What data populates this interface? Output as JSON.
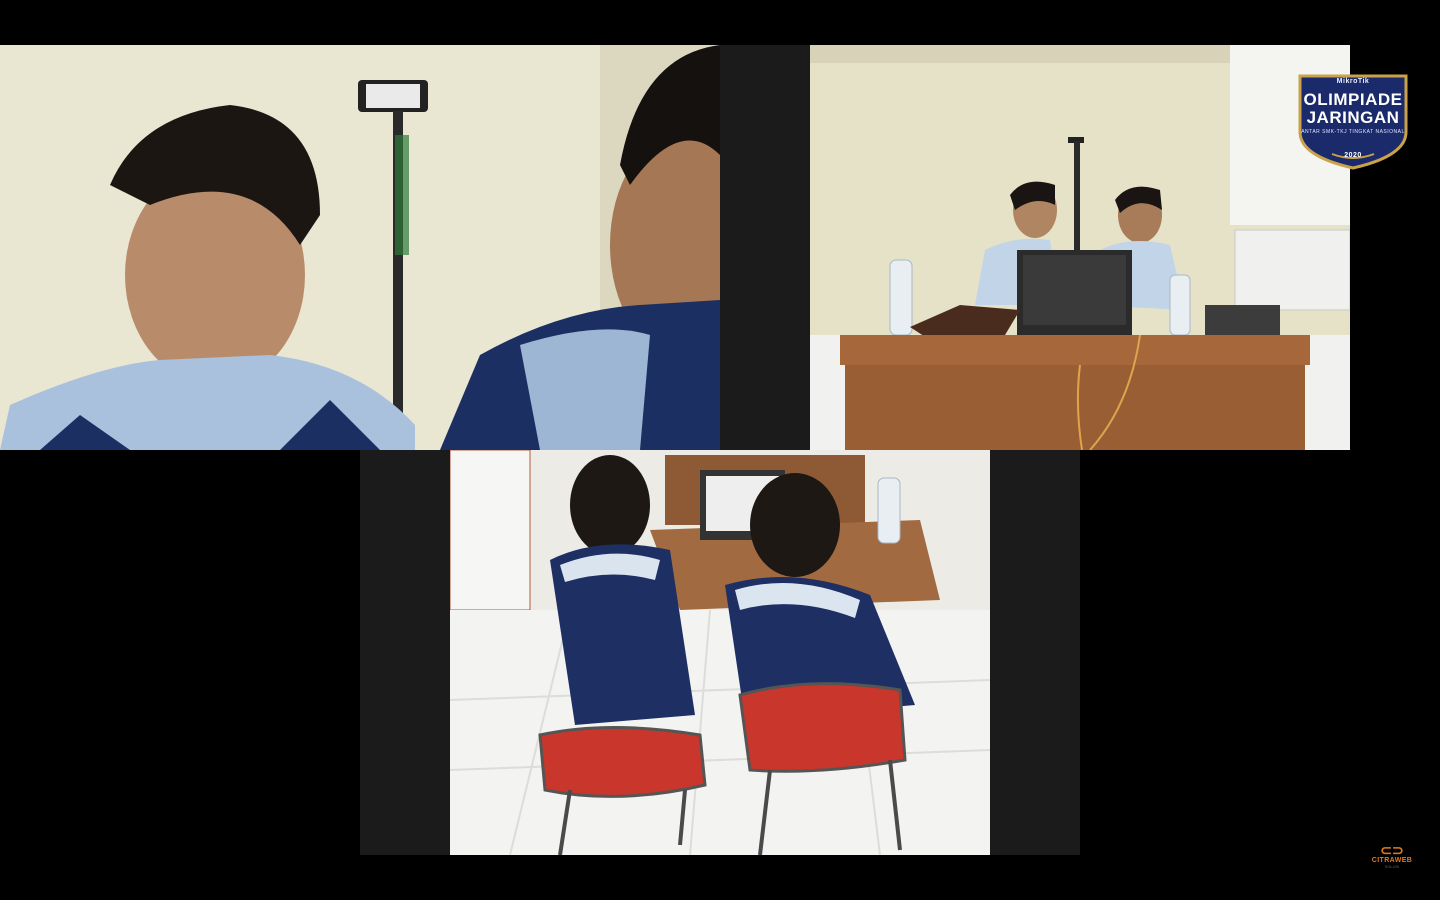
{
  "event_logo": {
    "brand": "MikroTik",
    "title_line1": "OLIMPIADE",
    "title_line2": "JARINGAN",
    "subtitle": "ANTAR SMK-TKJ TINGKAT NASIONAL",
    "year": "2020"
  },
  "sponsor_logo": {
    "mark": "⊂⊃",
    "name": "CITRAWEB",
    "tagline": "SOLUSI"
  },
  "colors": {
    "background": "#000000",
    "logo_navy": "#1b2a6b",
    "logo_gold": "#c9a24a",
    "sponsor_orange": "#e07a20"
  }
}
